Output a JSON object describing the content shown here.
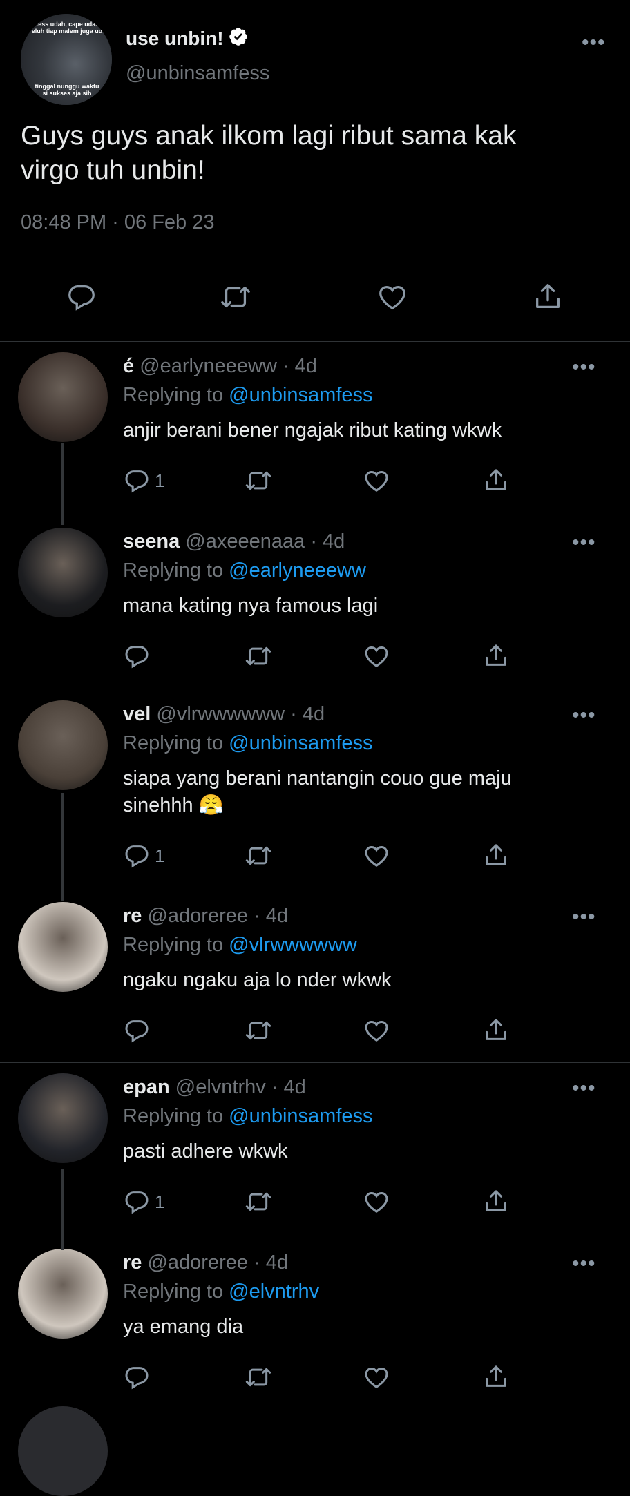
{
  "main_tweet": {
    "display_name": "use unbin!",
    "handle": "@unbinsamfess",
    "text": "Guys guys anak ilkom lagi ribut sama kak virgo tuh unbin!",
    "timestamp": "08:48 PM · 06 Feb 23",
    "avatar_caption_top": "..ess udah, cape udah\neluh tiap malem juga ud",
    "avatar_caption_bottom": "tinggal nunggu waktu\nsi sukses aja sih"
  },
  "replies": [
    {
      "name": "é",
      "handle": "@earlyneeeww",
      "time": "· 4d",
      "replying_label": "Replying to",
      "replying_to": "@unbinsamfess",
      "text": "anjir berani bener ngajak ribut kating wkwk",
      "reply_count": "1",
      "avatar_color": "#3a2f2a"
    },
    {
      "name": "seena",
      "handle": "@axeeenaaa",
      "time": "· 4d",
      "replying_label": "Replying to",
      "replying_to": "@earlyneeeww",
      "text": "mana kating nya famous lagi",
      "reply_count": "",
      "avatar_color": "#1c1d20"
    },
    {
      "name": "vel",
      "handle": "@vlrwwwwww",
      "time": "· 4d",
      "replying_label": "Replying to",
      "replying_to": "@unbinsamfess",
      "text": "siapa yang berani nantangin couo gue maju sinehhh 😤",
      "reply_count": "1",
      "avatar_color": "#4a4038"
    },
    {
      "name": "re",
      "handle": "@adoreree",
      "time": "· 4d",
      "replying_label": "Replying to",
      "replying_to": "@vlrwwwwww",
      "text": "ngaku ngaku aja lo nder wkwk",
      "reply_count": "",
      "avatar_color": "#cfc7be"
    },
    {
      "name": "epan",
      "handle": "@elvntrhv",
      "time": "· 4d",
      "replying_label": "Replying to",
      "replying_to": "@unbinsamfess",
      "text": "pasti adhere wkwk",
      "reply_count": "1",
      "avatar_color": "#22242a"
    },
    {
      "name": "re",
      "handle": "@adoreree",
      "time": "· 4d",
      "replying_label": "Replying to",
      "replying_to": "@elvntrhv",
      "text": "ya emang dia",
      "reply_count": "",
      "avatar_color": "#cfc7be"
    }
  ],
  "colors": {
    "background": "#000000",
    "text": "#e7e9ea",
    "muted": "#71767b",
    "link": "#1d9bf0",
    "verified": "#ffffff"
  },
  "icons": {
    "reply": "comment-icon",
    "retweet": "retweet-icon",
    "like": "heart-icon",
    "share": "share-icon",
    "more": "more-icon",
    "verified": "verified-badge-icon"
  }
}
